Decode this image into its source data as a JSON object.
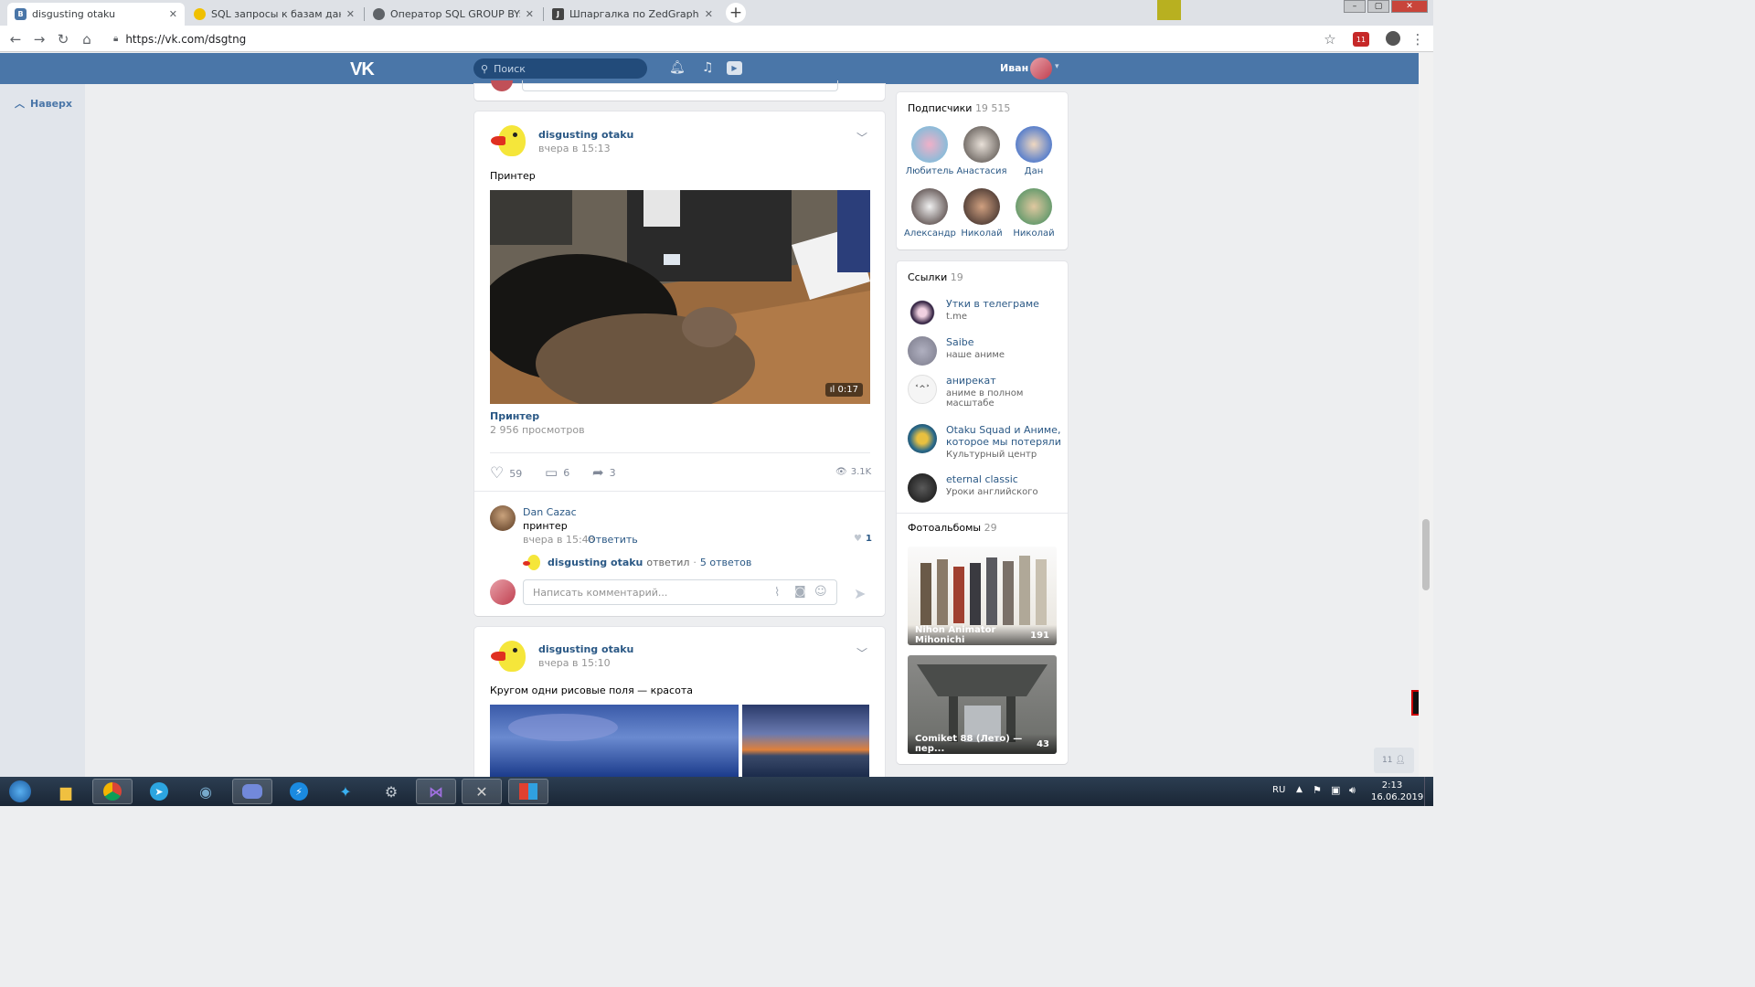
{
  "browser": {
    "tabs": [
      {
        "title": "disgusting otaku",
        "active": true,
        "favicon": "vk-icon"
      },
      {
        "title": "SQL запросы к базам данных за",
        "active": false,
        "favicon": "site-icon"
      },
      {
        "title": "Оператор SQL GROUP BY: синта",
        "active": false,
        "favicon": "globe-icon"
      },
      {
        "title": "Шпаргалка по ZedGraph. Как на",
        "active": false,
        "favicon": "doc-icon"
      }
    ],
    "url": "https://vk.com/dsgtng"
  },
  "vk_header": {
    "logo": "VK",
    "search_placeholder": "Поиск",
    "user_name": "Иван"
  },
  "left_nav": {
    "back_to_top": "Наверх"
  },
  "post1": {
    "author": "disgusting otaku",
    "date": "вчера в 15:13",
    "text": "Принтер",
    "video": {
      "duration": "0:17",
      "title": "Принтер",
      "views": "2 956 просмотров"
    },
    "likes": "59",
    "comments": "6",
    "shares": "3",
    "views": "3.1K",
    "comment": {
      "author": "Dan Cazac",
      "text": "принтер",
      "date": "вчера в 15:48",
      "reply_label": "Ответить",
      "likes": "1"
    },
    "reply_summary": {
      "author": "disgusting otaku",
      "verb": "ответил",
      "sep": "·",
      "count": "5 ответов"
    },
    "comment_placeholder": "Написать комментарий..."
  },
  "post2": {
    "author": "disgusting otaku",
    "date": "вчера в 15:10",
    "text": "Кругом одни рисовые поля — красота"
  },
  "sidebar": {
    "subscribers": {
      "title": "Подписчики",
      "count": "19 515",
      "members": [
        {
          "name": "Любитель"
        },
        {
          "name": "Анастасия"
        },
        {
          "name": "Дан"
        },
        {
          "name": "Александр"
        },
        {
          "name": "Николай"
        },
        {
          "name": "Николай"
        }
      ]
    },
    "links": {
      "title": "Ссылки",
      "count": "19",
      "items": [
        {
          "name": "Утки в телеграме",
          "desc": "t.me"
        },
        {
          "name": "Saibe",
          "desc": "наше аниме"
        },
        {
          "name": "анирекат",
          "desc": "аниме в полном масштабе"
        },
        {
          "name": "Otaku Squad и Аниме, которое мы потеряли",
          "desc": "Культурный центр"
        },
        {
          "name": "eternal classic",
          "desc": "Уроки английского"
        }
      ]
    },
    "albums": {
      "title": "Фотоальбомы",
      "count": "29",
      "items": [
        {
          "name": "Nihon Animator Mihonichi",
          "count": "191"
        },
        {
          "name": "Comiket 88 (Лето) — пер...",
          "count": "43"
        }
      ]
    }
  },
  "online_badge": "11",
  "taskbar": {
    "lang": "RU",
    "time": "2:13",
    "date": "16.06.2019"
  },
  "colors": {
    "vk_blue": "#4a76a8",
    "link": "#2a5885"
  }
}
